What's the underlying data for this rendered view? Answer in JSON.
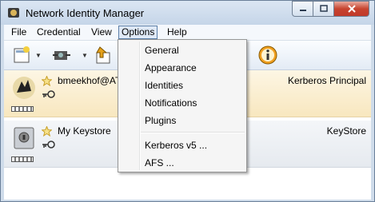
{
  "window": {
    "title": "Network Identity Manager"
  },
  "menubar": {
    "items": [
      "File",
      "Credential",
      "View",
      "Options",
      "Help"
    ],
    "active": "Options"
  },
  "options_menu": {
    "group1": [
      "General",
      "Appearance",
      "Identities",
      "Notifications",
      "Plugins"
    ],
    "group2": [
      "Kerberos v5 ...",
      "AFS ..."
    ]
  },
  "identities": [
    {
      "name": "bmeekhof@ATI",
      "type": "Kerberos Principal"
    },
    {
      "name": "My Keystore",
      "type": "KeyStore"
    }
  ],
  "colors": {
    "selected_row": "#f8e7bf",
    "menu_highlight": "#dfe9f6",
    "close_button": "#c7442f"
  }
}
